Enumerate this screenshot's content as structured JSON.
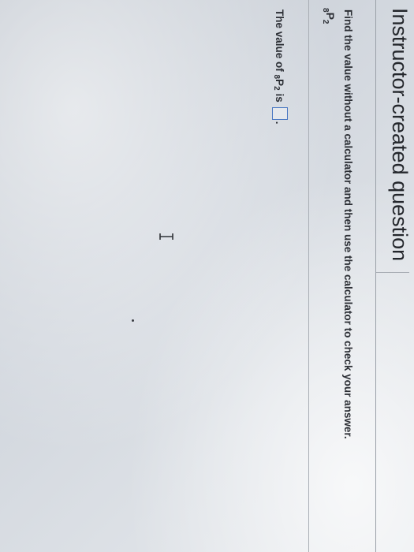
{
  "header": {
    "title": "Instructor-created question"
  },
  "question": {
    "instruction": "Find the value without a calculator and then use the calculator to check your answer.",
    "expression": {
      "left_sub": "8",
      "symbol": "P",
      "right_sub": "2"
    }
  },
  "answer": {
    "prefix": "The value of",
    "left_sub": "8",
    "symbol": "P",
    "right_sub": "2",
    "verb": "is",
    "suffix": ".",
    "value": ""
  },
  "icons": {
    "cursor": "text-cursor-icon"
  },
  "colors": {
    "answer_box_border": "#4a78c2",
    "text": "#2c2f35"
  }
}
